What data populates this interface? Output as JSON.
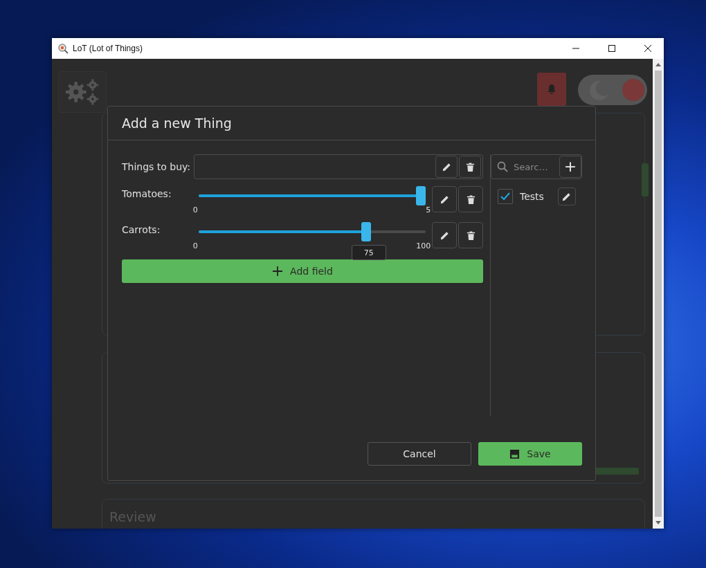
{
  "window": {
    "title": "LoT (Lot of Things)"
  },
  "header": {
    "theme_toggle": {
      "on": true
    }
  },
  "background": {
    "cards": [
      {
        "kind": "plain"
      },
      {
        "kind": "actions"
      },
      {
        "kind": "titled",
        "title": "Review"
      }
    ]
  },
  "dialog": {
    "title": "Add a new Thing",
    "fields": [
      {
        "kind": "text",
        "label": "Things to buy:"
      },
      {
        "kind": "slider",
        "label": "Tomatoes:",
        "level": 1.0,
        "min": "0",
        "max": "5"
      },
      {
        "kind": "slider",
        "label": "Carrots:",
        "level": 0.75,
        "min": "0",
        "max": "100",
        "tooltip": "75"
      }
    ],
    "add_field": {
      "label": "Add field"
    },
    "tag_panel": {
      "search": {
        "placeholder": "Searc…"
      },
      "add": "+",
      "tags": [
        {
          "label": "Tests",
          "checked": true
        }
      ]
    },
    "buttons": [
      {
        "kind": "secondary",
        "label": "Cancel"
      },
      {
        "kind": "primary",
        "label": "Save"
      }
    ]
  }
}
